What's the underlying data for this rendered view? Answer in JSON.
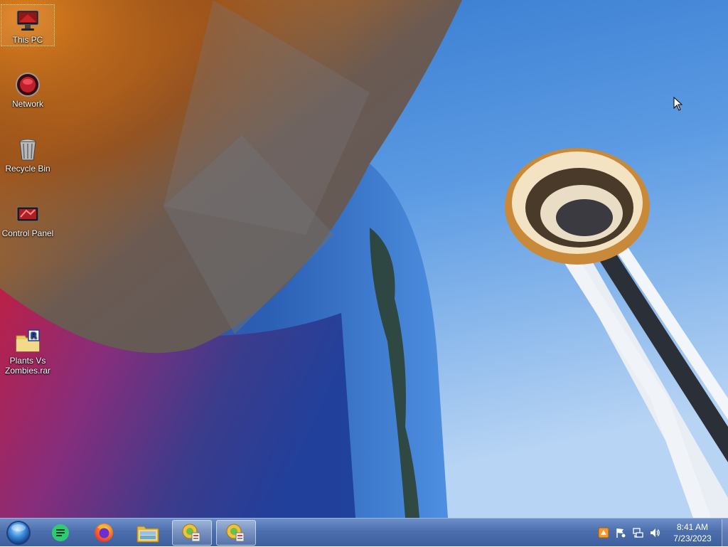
{
  "desktop": {
    "icons": [
      {
        "label": "This PC",
        "icon": "computer-icon",
        "selected": true
      },
      {
        "label": "Network",
        "icon": "network-icon"
      },
      {
        "label": "Recycle Bin",
        "icon": "recycle-bin-icon"
      },
      {
        "label": "Control Panel",
        "icon": "control-panel-icon"
      },
      {
        "label_line1": "Plants Vs",
        "label_line2": "Zombies.rar",
        "icon": "rar-archive-icon"
      }
    ]
  },
  "taskbar": {
    "start": {
      "icon": "start-orb-icon"
    },
    "pinned": [
      {
        "icon": "notes-app-icon",
        "color": "#2ecc71"
      },
      {
        "icon": "firefox-icon"
      },
      {
        "icon": "file-explorer-icon"
      }
    ],
    "running": [
      {
        "icon": "installer-app-icon"
      },
      {
        "icon": "installer-app-icon"
      }
    ]
  },
  "tray": {
    "icons": [
      "winrar-tray-icon",
      "action-center-flag-icon",
      "network-tray-icon",
      "volume-icon"
    ],
    "time": "8:41 AM",
    "date": "7/23/2023"
  },
  "colors": {
    "taskbar": "#4d6fae",
    "sky": "#5a9ae2",
    "needle_orange": "#d9902e"
  }
}
